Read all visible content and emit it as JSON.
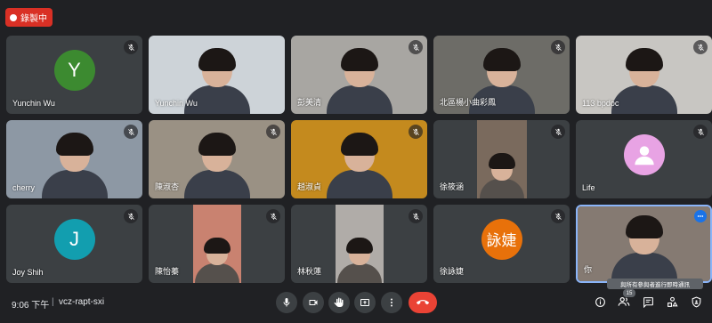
{
  "recording": {
    "label": "錄製中",
    "color": "#d93025"
  },
  "participants": [
    {
      "name": "Yunchin Wu",
      "type": "avatar",
      "initial": "Y",
      "avatar_color": "#3c8a30",
      "muted": true
    },
    {
      "name": "Yunchin Wu",
      "type": "camera",
      "bg": "#cdd3d8",
      "muted": false
    },
    {
      "name": "彭美清",
      "type": "camera",
      "bg": "#a8a6a2",
      "muted": true
    },
    {
      "name": "北區楊小曲彩鳳",
      "type": "camera",
      "bg": "#6d6c67",
      "muted": true
    },
    {
      "name": "113 bpdoc",
      "type": "camera",
      "bg": "#c8c6c2",
      "muted": true
    },
    {
      "name": "cherry",
      "type": "camera",
      "bg": "#8d98a4",
      "muted": true
    },
    {
      "name": "陳淑杏",
      "type": "camera",
      "bg": "#9a9184",
      "muted": true
    },
    {
      "name": "趙淑貞",
      "type": "camera",
      "bg": "#c48a1e",
      "muted": true
    },
    {
      "name": "徐筱涵",
      "type": "inset",
      "bg": "#7a6a5d",
      "muted": true
    },
    {
      "name": "Life",
      "type": "avatar-default",
      "avatar_color": "#e8a3e4",
      "muted": true
    },
    {
      "name": "Joy Shih",
      "type": "avatar",
      "initial": "J",
      "avatar_color": "#129eaf",
      "muted": true
    },
    {
      "name": "陳怡蓁",
      "type": "inset",
      "bg": "#c98270",
      "muted": true
    },
    {
      "name": "林秋蓮",
      "type": "inset",
      "bg": "#b0aca8",
      "muted": true
    },
    {
      "name": "徐詠婕",
      "type": "avatar",
      "initial": "詠婕",
      "avatar_color": "#e8710a",
      "muted": true
    },
    {
      "name": "你",
      "type": "camera",
      "bg": "#857a72",
      "muted": false,
      "presenting": true
    }
  ],
  "toolbar": {
    "time": "9:06 下午",
    "separator": "|",
    "meeting_code": "vcz-rapt-sxi",
    "participant_count": "15",
    "tooltip": "與所有參與者進行即時通訊"
  }
}
